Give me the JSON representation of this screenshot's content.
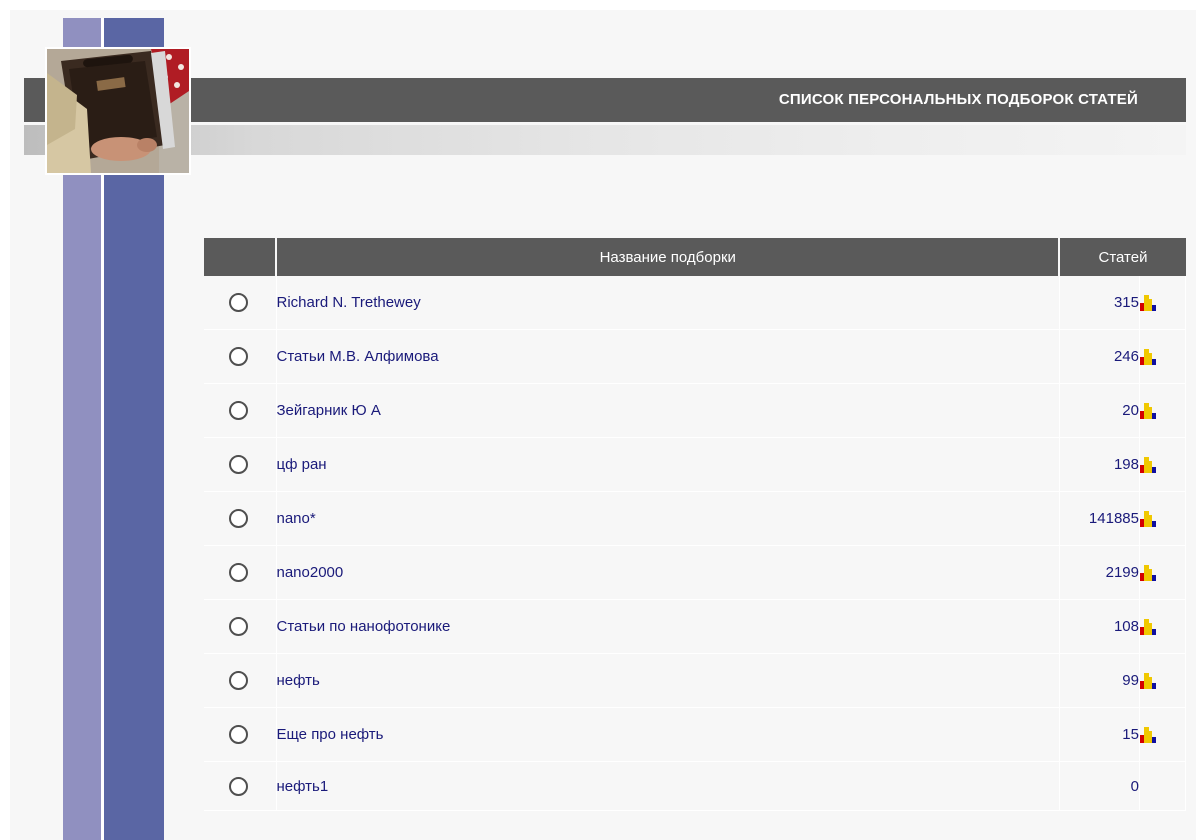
{
  "header": {
    "title": "СПИСОК ПЕРСОНАЛЬНЫХ ПОДБОРОК СТАТЕЙ"
  },
  "table": {
    "columns": {
      "name": "Название подборки",
      "count": "Статей"
    },
    "rows": [
      {
        "name": "Richard N. Trethewey",
        "count": "315",
        "has_stats": true
      },
      {
        "name": "Статьи М.В. Алфимова",
        "count": "246",
        "has_stats": true
      },
      {
        "name": "Зейгарник Ю А",
        "count": "20",
        "has_stats": true
      },
      {
        "name": "цф ран",
        "count": "198",
        "has_stats": true
      },
      {
        "name": "nano*",
        "count": "141885",
        "has_stats": true
      },
      {
        "name": "nano2000",
        "count": "2199",
        "has_stats": true
      },
      {
        "name": "Статьи по нанофотонике",
        "count": "108",
        "has_stats": true
      },
      {
        "name": "нефть",
        "count": "99",
        "has_stats": true
      },
      {
        "name": "Еще про нефть",
        "count": "15",
        "has_stats": true
      },
      {
        "name": "нефть1",
        "count": "0",
        "has_stats": false
      }
    ]
  },
  "icons": {
    "row_stats": "bar-chart-icon",
    "row_select": "radio-button"
  },
  "colors": {
    "header_bg": "#5a5a5a",
    "stripe_light": "#9090c0",
    "stripe_dark": "#5a66a4",
    "link": "#1a1a7a",
    "chart_red": "#d40000",
    "chart_yellow": "#f0c800",
    "chart_blue": "#1010a0"
  }
}
